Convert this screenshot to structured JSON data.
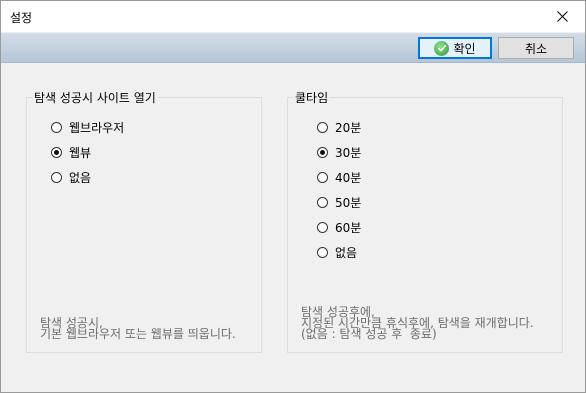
{
  "window": {
    "title": "설정"
  },
  "toolbar": {
    "ok_label": "확인",
    "cancel_label": "취소"
  },
  "left_group": {
    "legend": "탐색 성공시 사이트 열기",
    "options": [
      {
        "label": "웹브라우저",
        "selected": false
      },
      {
        "label": "웹뷰",
        "selected": true
      },
      {
        "label": "없음",
        "selected": false
      }
    ],
    "note": [
      "탐색 성공시,",
      "기본 웹브라우저 또는 웹뷰를 띄웁니다."
    ]
  },
  "right_group": {
    "legend": "쿨타임",
    "options": [
      {
        "label": "20분",
        "selected": false
      },
      {
        "label": "30분",
        "selected": true
      },
      {
        "label": "40분",
        "selected": false
      },
      {
        "label": "50분",
        "selected": false
      },
      {
        "label": "60분",
        "selected": false
      },
      {
        "label": "없음",
        "selected": false
      }
    ],
    "note": [
      "탐색 성공후에,",
      "지정된 시간만큼 휴식후에, 탐색을 재개합니다.",
      "(없음 : 탐색 성공 후  종료)"
    ]
  }
}
